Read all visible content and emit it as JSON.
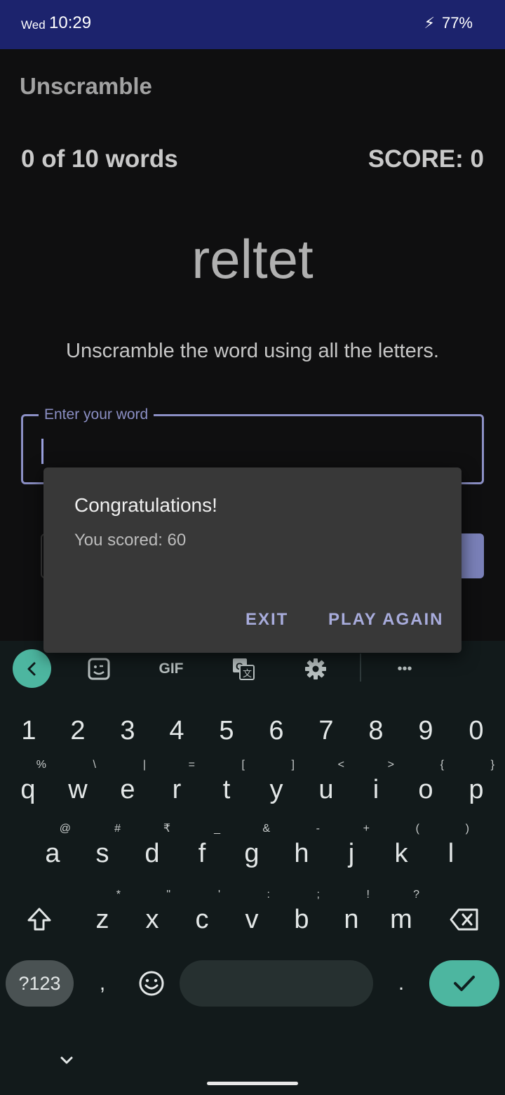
{
  "status_bar": {
    "day": "Wed",
    "time": "10:29",
    "battery": "77%",
    "bolt": "⚡",
    "color": "#1c236d"
  },
  "app": {
    "title": "Unscramble",
    "word_count": "0 of 10 words",
    "score": "SCORE: 0",
    "scrambled_word": "reltet",
    "instructions": "Unscramble the word using all the letters.",
    "input": {
      "label": "Enter your word",
      "value": ""
    }
  },
  "dialog": {
    "title": "Congratulations!",
    "message": "You scored: 60",
    "exit_label": "EXIT",
    "play_again_label": "PLAY AGAIN",
    "accent_color": "#a8acdc"
  },
  "keyboard": {
    "toolbar": [
      "back-icon",
      "sticker-icon",
      "GIF",
      "translate-icon",
      "gear-icon",
      "more-icon"
    ],
    "gif_label": "GIF",
    "more_label": "•••",
    "numbers": [
      "1",
      "2",
      "3",
      "4",
      "5",
      "6",
      "7",
      "8",
      "9",
      "0"
    ],
    "row1": [
      {
        "key": "q",
        "hint": "%"
      },
      {
        "key": "w",
        "hint": "\\"
      },
      {
        "key": "e",
        "hint": "|"
      },
      {
        "key": "r",
        "hint": "="
      },
      {
        "key": "t",
        "hint": "["
      },
      {
        "key": "y",
        "hint": "]"
      },
      {
        "key": "u",
        "hint": "<"
      },
      {
        "key": "i",
        "hint": ">"
      },
      {
        "key": "o",
        "hint": "{"
      },
      {
        "key": "p",
        "hint": "}"
      }
    ],
    "row2": [
      {
        "key": "a",
        "hint": "@"
      },
      {
        "key": "s",
        "hint": "#"
      },
      {
        "key": "d",
        "hint": "₹"
      },
      {
        "key": "f",
        "hint": "_"
      },
      {
        "key": "g",
        "hint": "&"
      },
      {
        "key": "h",
        "hint": "-"
      },
      {
        "key": "j",
        "hint": "+"
      },
      {
        "key": "k",
        "hint": "("
      },
      {
        "key": "l",
        "hint": ")"
      }
    ],
    "row3": [
      {
        "key": "z",
        "hint": "*"
      },
      {
        "key": "x",
        "hint": "\""
      },
      {
        "key": "c",
        "hint": "'"
      },
      {
        "key": "v",
        "hint": ":"
      },
      {
        "key": "b",
        "hint": ";"
      },
      {
        "key": "n",
        "hint": "!"
      },
      {
        "key": "m",
        "hint": "?"
      }
    ],
    "symbols_label": "?123",
    "comma": ",",
    "period": ".",
    "accent_color": "#4db6a0"
  }
}
